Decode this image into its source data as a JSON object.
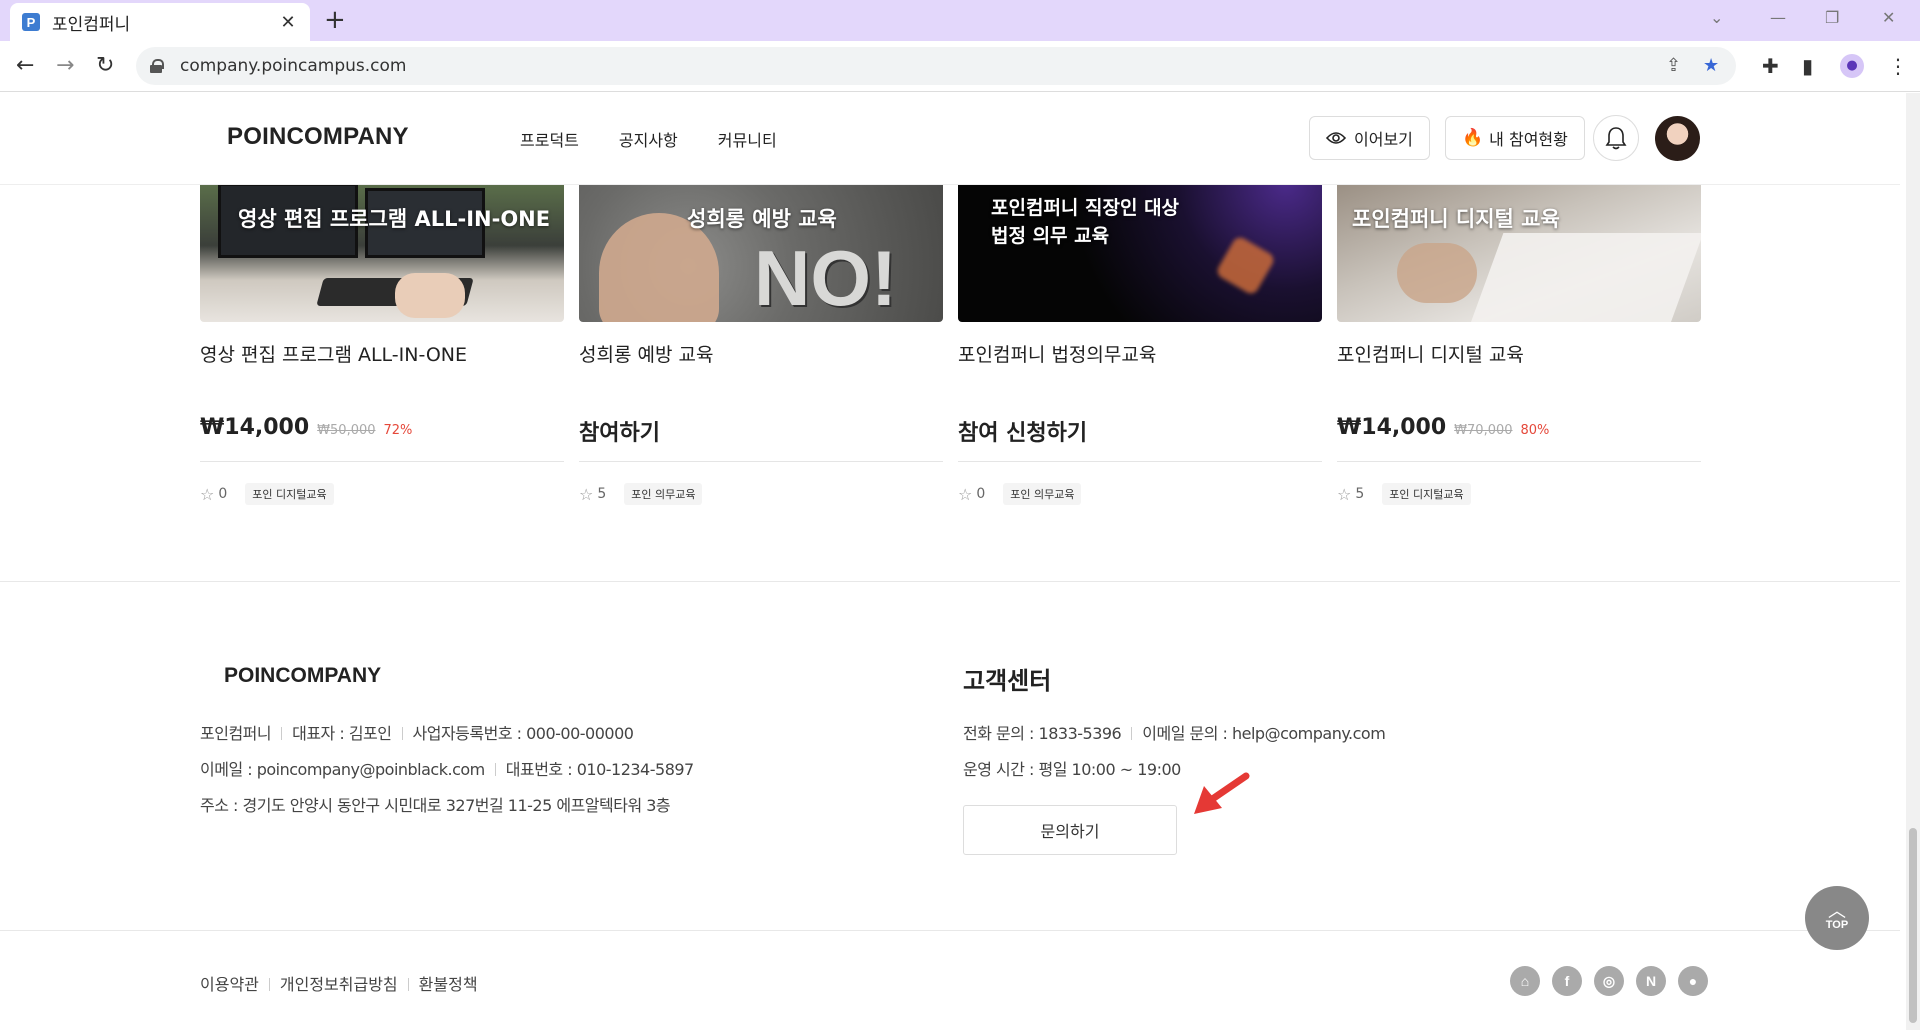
{
  "browser": {
    "tab_title": "포인컴퍼니",
    "favicon_letter": "P",
    "url": "company.poincampus.com"
  },
  "header": {
    "logo": "POINCOMPANY",
    "nav": [
      "프로덕트",
      "공지사항",
      "커뮤니티"
    ],
    "continue_label": "이어보기",
    "my_status_label": "내 참여현황"
  },
  "courses": [
    {
      "thumb_text": "영상 편집 프로그램 ALL-IN-ONE",
      "title": "영상 편집 프로그램 ALL-IN-ONE",
      "price": "₩14,000",
      "original_price": "₩50,000",
      "discount": "72%",
      "rating": "0",
      "tag": "포인 디지털교육"
    },
    {
      "thumb_text": "성희롱 예방 교육",
      "thumb_extra": "NO!",
      "title": "성희롱 예방 교육",
      "cta": "참여하기",
      "rating": "5",
      "tag": "포인 의무교육"
    },
    {
      "thumb_text_1": "포인컴퍼니 직장인 대상",
      "thumb_text_2": "법정 의무 교육",
      "title": "포인컴퍼니 법정의무교육",
      "cta": "참여 신청하기",
      "rating": "0",
      "tag": "포인 의무교육"
    },
    {
      "thumb_text": "포인컴퍼니 디지털 교육",
      "title": "포인컴퍼니 디지털 교육",
      "price": "₩14,000",
      "original_price": "₩70,000",
      "discount": "80%",
      "rating": "5",
      "tag": "포인 디지털교육"
    }
  ],
  "footer": {
    "logo": "POINCOMPANY",
    "company_name": "포인컴퍼니",
    "ceo": "대표자 : 김포인",
    "biz_no": "사업자등록번호 : 000-00-00000",
    "email": "이메일 : poincompany@poinblack.com",
    "phone": "대표번호 : 010-1234-5897",
    "address": "주소 : 경기도 안양시 동안구 시민대로 327번길 11-25 에프알텍타워 3층",
    "cs_title": "고객센터",
    "cs_phone": "전화 문의 : 1833-5396",
    "cs_email": "이메일 문의 : help@company.com",
    "cs_hours": "운영 시간 : 평일 10:00 ~ 19:00",
    "inquiry_label": "문의하기",
    "terms": "이용약관",
    "privacy": "개인정보취급방침",
    "refund": "환불정책",
    "top_label": "TOP"
  },
  "icons": {
    "sns": [
      "home-icon",
      "facebook-icon",
      "instagram-icon",
      "naver-icon",
      "kakao-icon"
    ]
  },
  "colors": {
    "tabbar_bg": "#e3d7fb",
    "discount": "#e5483a",
    "arrow": "#e53935",
    "bookmark_star": "#3867d6"
  }
}
